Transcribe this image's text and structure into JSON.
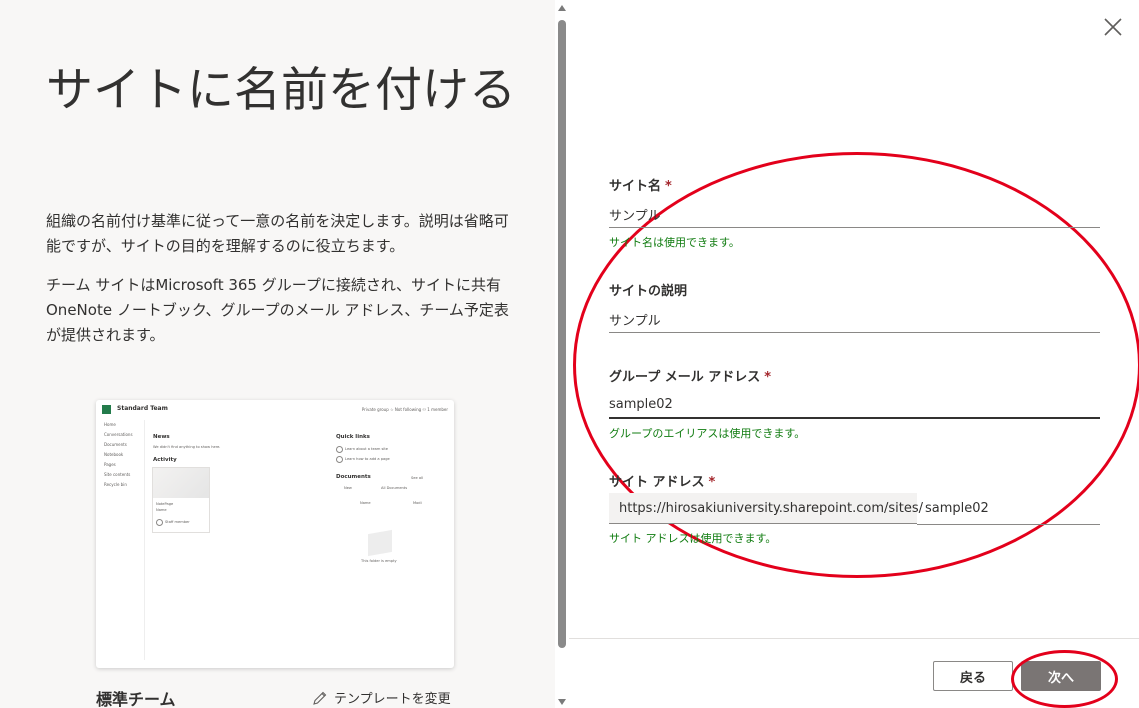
{
  "left": {
    "title": "サイトに名前を付ける",
    "description1": "組織の名前付け基準に従って一意の名前を決定します。説明は省略可能ですが、サイトの目的を理解するのに役立ちます。",
    "description2": "チーム サイトはMicrosoft 365 グループに接続され、サイトに共有 OneNote ノートブック、グループのメール アドレス、チーム予定表が提供されます。",
    "template_name": "標準チーム",
    "change_template": "テンプレートを変更",
    "preview": {
      "site_name": "Standard Team",
      "meta": "Private group  ☆ Not following  ⚇ 1 member",
      "nav": [
        "Home",
        "Conversations",
        "Documents",
        "Notebook",
        "Pages",
        "Site contents",
        "Recycle bin"
      ],
      "news_title": "News",
      "news_text": "We didn't find anything to show here.",
      "activity_title": "Activity",
      "card_title": "NotePage",
      "card_sub": "Name",
      "card_person": "Staff member",
      "quick_links_title": "Quick links",
      "quick_link_1": "Learn about a team site",
      "quick_link_2": "Learn how to add a page",
      "documents_title": "Documents",
      "see_all": "See all",
      "doc_tab_1": "New",
      "doc_tab_2": "All Documents",
      "col_name": "Name",
      "col_modified": "Modi",
      "empty_text": "This folder is empty"
    }
  },
  "form": {
    "site_name_label": "サイト名",
    "site_name_value": "サンプル",
    "site_name_ok": "サイト名は使用できます。",
    "site_desc_label": "サイトの説明",
    "site_desc_value": "サンプル",
    "group_email_label": "グループ メール アドレス",
    "group_email_value": "sample02",
    "group_email_ok": "グループのエイリアスは使用できます。",
    "site_address_label": "サイト アドレス",
    "site_address_prefix": "https://hirosakiuniversity.sharepoint.com/sites/",
    "site_address_value": "sample02",
    "site_address_ok": "サイト アドレスは使用できます。",
    "required_mark": "*"
  },
  "footer": {
    "back_label": "戻る",
    "next_label": "次へ"
  },
  "colors": {
    "success": "#107c10",
    "required": "#a4262c",
    "annotation": "#e3001b",
    "primary_button": "#7a7574"
  }
}
